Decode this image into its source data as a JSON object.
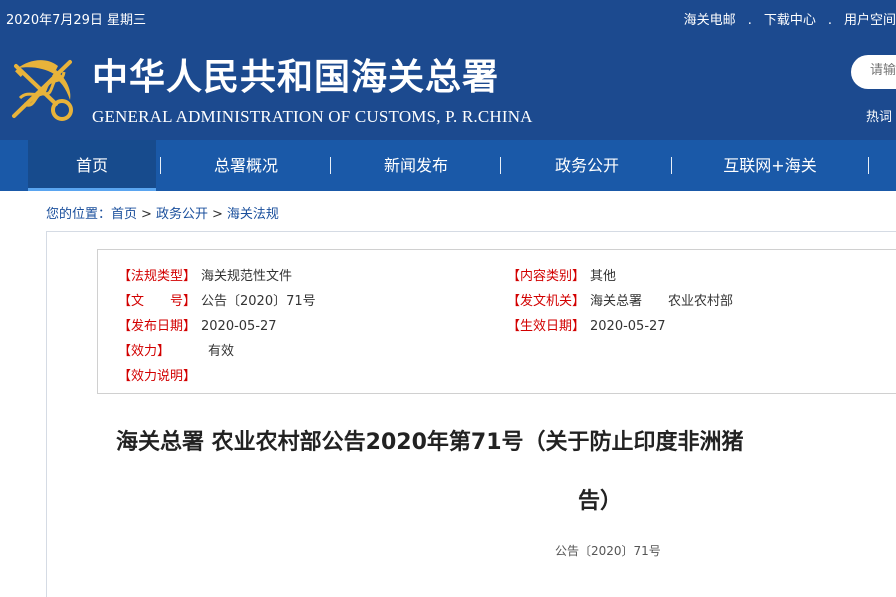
{
  "topbar": {
    "date": "2020年7月29日 星期三",
    "links": [
      "海关电邮",
      "下载中心",
      "用户空间"
    ],
    "separator": "."
  },
  "site": {
    "title_cn": "中华人民共和国海关总署",
    "title_en": "GENERAL ADMINISTRATION OF CUSTOMS, P. R.CHINA"
  },
  "search": {
    "placeholder": "请输",
    "hot_label": "热词"
  },
  "nav": {
    "items": [
      "首页",
      "总署概况",
      "新闻发布",
      "政务公开",
      "互联网+海关"
    ],
    "active_index": 0,
    "separator": "|"
  },
  "breadcrumb": {
    "prefix": "您的位置：",
    "items": [
      "首页",
      "政务公开",
      "海关法规"
    ],
    "separator": ">"
  },
  "meta": {
    "law_type_label": "【法规类型】",
    "law_type": "海关规范性文件",
    "content_category_label": "【内容类别】",
    "content_category": "其他",
    "doc_number_label": "【文　　号】",
    "doc_number": "公告〔2020〕71号",
    "issuing_org_label": "【发文机关】",
    "issuing_org": "海关总署　　农业农村部",
    "publish_date_label": "【发布日期】",
    "publish_date": "2020-05-27",
    "effective_date_label": "【生效日期】",
    "effective_date": "2020-05-27",
    "validity_label": "【效力】",
    "validity": "有效",
    "validity_note_label": "【效力说明】",
    "validity_note": ""
  },
  "document": {
    "title_line1": "海关总署 农业农村部公告2020年第71号（关于防止印度非洲猪",
    "title_line2": "告）",
    "number": "公告〔2020〕71号"
  },
  "colors": {
    "header_bg": "#1c4a8f",
    "nav_bg": "#1a59a8",
    "label_red": "#d20000",
    "link_blue": "#1a4f9c"
  }
}
